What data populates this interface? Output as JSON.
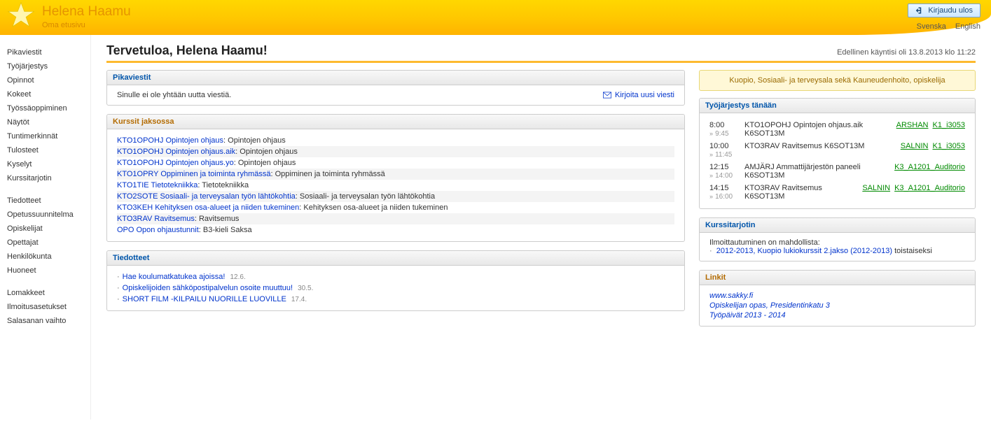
{
  "header": {
    "title": "Helena Haamu",
    "subtitle": "Oma etusivu",
    "logout": "Kirjaudu ulos",
    "langs": [
      "Svenska",
      "English"
    ]
  },
  "sidebar": {
    "g1": [
      "Pikaviestit",
      "Työjärjestys",
      "Opinnot",
      "Kokeet",
      "Työssäoppiminen",
      "Näytöt",
      "Tuntimerkinnät",
      "Tulosteet",
      "Kyselyt",
      "Kurssitarjotin"
    ],
    "g2": [
      "Tiedotteet",
      "Opetussuunnitelma",
      "Opiskelijat",
      "Opettajat",
      "Henkilökunta",
      "Huoneet"
    ],
    "g3": [
      "Lomakkeet",
      "Ilmoitusasetukset",
      "Salasanan vaihto"
    ]
  },
  "main": {
    "welcome": "Tervetuloa, Helena Haamu!",
    "last_visit": "Edellinen käyntisi oli 13.8.2013 klo 11:22"
  },
  "messages": {
    "title": "Pikaviestit",
    "empty": "Sinulle ei ole yhtään uutta viestiä.",
    "compose": "Kirjoita uusi viesti"
  },
  "courses": {
    "title": "Kurssit jaksossa",
    "rows": [
      {
        "link": "KTO1OPOHJ Opintojen ohjaus",
        "desc": "Opintojen ohjaus"
      },
      {
        "link": "KTO1OPOHJ Opintojen ohjaus.aik",
        "desc": "Opintojen ohjaus"
      },
      {
        "link": "KTO1OPOHJ Opintojen ohjaus.yo",
        "desc": "Opintojen ohjaus"
      },
      {
        "link": "KTO1OPRY Oppiminen ja toiminta ryhmässä",
        "desc": "Oppiminen ja toiminta ryhmässä"
      },
      {
        "link": "KTO1TIE Tietotekniikka",
        "desc": "Tietotekniikka"
      },
      {
        "link": "KTO2SOTE Sosiaali- ja terveysalan työn lähtökohtia",
        "desc": "Sosiaali- ja terveysalan työn lähtökohtia"
      },
      {
        "link": "KTO3KEH Kehityksen osa-alueet ja niiden tukeminen",
        "desc": "Kehityksen osa-alueet ja niiden tukeminen"
      },
      {
        "link": "KTO3RAV Ravitsemus",
        "desc": "Ravitsemus"
      },
      {
        "link": "OPO Opon ohjaustunnit",
        "desc": "B3-kieli Saksa"
      }
    ]
  },
  "bulletins": {
    "title": "Tiedotteet",
    "rows": [
      {
        "text": "Hae koulumatkatukea ajoissa!",
        "date": "12.6."
      },
      {
        "text": "Opiskelijoiden sähköpostipalvelun osoite muuttuu!",
        "date": "30.5."
      },
      {
        "text": "SHORT FILM -KILPAILU NUORILLE LUOVILLE",
        "date": "17.4."
      }
    ]
  },
  "info_strip": "Kuopio, Sosiaali- ja terveysala sekä Kauneudenhoito, opiskelija",
  "schedule": {
    "title": "Työjärjestys tänään",
    "rows": [
      {
        "start": "8:00",
        "end": "9:45",
        "desc": "KTO1OPOHJ Opintojen ohjaus.aik K6SOT13M",
        "teacher": "ARSHAN",
        "room": "K1_i3053"
      },
      {
        "start": "10:00",
        "end": "11:45",
        "desc": "KTO3RAV Ravitsemus K6SOT13M",
        "teacher": "SALNIN",
        "room": "K1_i3053"
      },
      {
        "start": "12:15",
        "end": "14:00",
        "desc": "AMJÄRJ Ammattijärjestön paneeli K6SOT13M",
        "teacher": "",
        "room": "K3_A1201_Auditorio"
      },
      {
        "start": "14:15",
        "end": "16:00",
        "desc": "KTO3RAV Ravitsemus K6SOT13M",
        "teacher": "SALNIN",
        "room": "K3_A1201_Auditorio"
      }
    ]
  },
  "enroll": {
    "title": "Kurssitarjotin",
    "intro": "Ilmoittautuminen on mahdollista:",
    "link": "2012-2013, Kuopio lukiokurssit 2.jakso (2012-2013)",
    "suffix": "toistaiseksi"
  },
  "links": {
    "title": "Linkit",
    "rows": [
      "www.sakky.fi",
      "Opiskelijan opas, Presidentinkatu 3",
      "Työpäivät 2013 - 2014"
    ]
  }
}
